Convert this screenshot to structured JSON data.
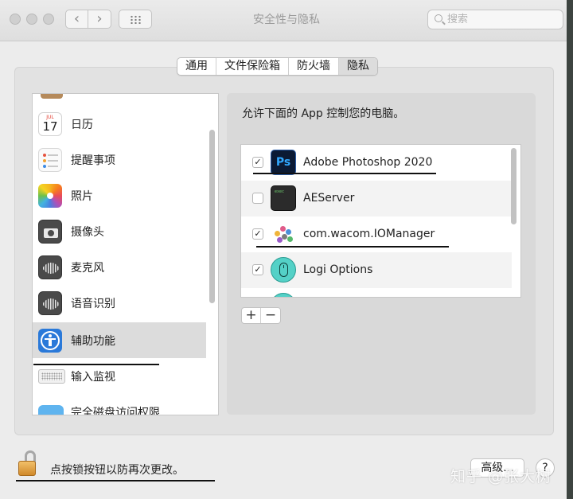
{
  "window": {
    "title": "安全性与隐私",
    "search_placeholder": "搜索",
    "nav_back": "‹",
    "nav_forward": "›"
  },
  "tabs": [
    {
      "label": "通用",
      "selected": false
    },
    {
      "label": "文件保险箱",
      "selected": false
    },
    {
      "label": "防火墙",
      "selected": false
    },
    {
      "label": "隐私",
      "selected": true
    }
  ],
  "sidebar": {
    "items": [
      {
        "label": "日历",
        "icon": "calendar-icon",
        "calendar_month": "JUL",
        "calendar_day": "17"
      },
      {
        "label": "提醒事项",
        "icon": "reminders-icon"
      },
      {
        "label": "照片",
        "icon": "photos-icon"
      },
      {
        "label": "摄像头",
        "icon": "camera-icon"
      },
      {
        "label": "麦克风",
        "icon": "microphone-icon"
      },
      {
        "label": "语音识别",
        "icon": "speech-recognition-icon"
      },
      {
        "label": "辅助功能",
        "icon": "accessibility-icon",
        "selected": true
      },
      {
        "label": "输入监视",
        "icon": "keyboard-icon"
      },
      {
        "label": "完全磁盘访问权限",
        "icon": "folder-icon"
      }
    ]
  },
  "main": {
    "description": "允许下面的 App 控制您的电脑。",
    "apps": [
      {
        "name": "Adobe Photoshop 2020",
        "checked": true,
        "icon": "photoshop-icon",
        "icon_text": "Ps"
      },
      {
        "name": "AEServer",
        "checked": false,
        "icon": "terminal-icon",
        "icon_text": "exec"
      },
      {
        "name": "com.wacom.IOManager",
        "checked": true,
        "icon": "wacom-icon"
      },
      {
        "name": "Logi Options",
        "checked": true,
        "icon": "logi-options-icon"
      }
    ],
    "add_label": "+",
    "remove_label": "−"
  },
  "footer": {
    "lock_text": "点按锁按钮以防再次更改。",
    "advanced_label": "高级...",
    "help_label": "?",
    "watermark": "知乎 @张大树"
  },
  "colors": {
    "selected_row": "#dcdcdc",
    "accessibility_blue": "#2a79d9",
    "photoshop_blue": "#31a8ff",
    "logi_teal": "#54d1c7"
  }
}
